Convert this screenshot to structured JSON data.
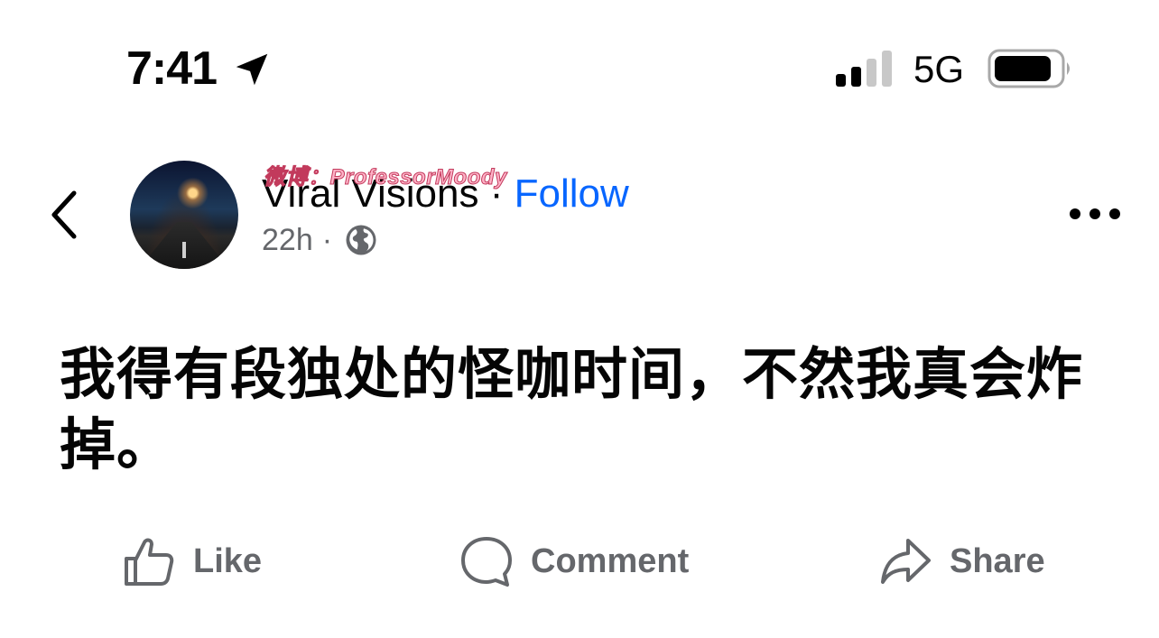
{
  "status_bar": {
    "time": "7:41",
    "network": "5G",
    "icons": [
      "location-arrow-icon",
      "signal-bars-icon",
      "battery-icon"
    ]
  },
  "post": {
    "author": "Viral Visions",
    "separator": "·",
    "follow_label": "Follow",
    "time_ago": "22h",
    "meta_separator": "·",
    "privacy_icon": "globe-icon",
    "watermark": "微博：ProfessorMoody",
    "text": "我得有段独处的怪咖时间，不然我真会炸掉。"
  },
  "actions": {
    "like_label": "Like",
    "comment_label": "Comment",
    "share_label": "Share"
  },
  "colors": {
    "follow": "#0866ff",
    "secondary_text": "#65676b",
    "primary_text": "#050505"
  }
}
